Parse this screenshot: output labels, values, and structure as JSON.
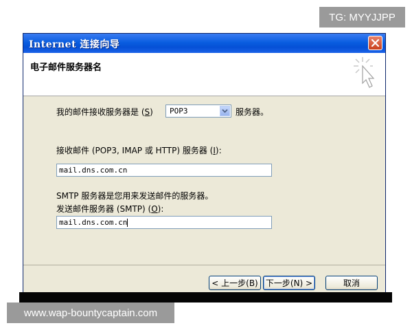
{
  "window": {
    "title": "Internet 连接向导"
  },
  "header": {
    "title": "电子邮件服务器名"
  },
  "incoming_type": {
    "label_prefix": "我的邮件接收服务器是 (",
    "label_key": "S",
    "label_suffix": ")",
    "selected": "POP3",
    "trailing": "服务器。"
  },
  "incoming_server": {
    "label_prefix": "接收邮件 (POP3, IMAP 或 HTTP) 服务器 (",
    "label_key": "I",
    "label_suffix": "):",
    "value": "mail.dns.com.cn"
  },
  "smtp_info": "SMTP 服务器是您用来发送邮件的服务器。",
  "outgoing_server": {
    "label_prefix": "发送邮件服务器 (SMTP) (",
    "label_key": "O",
    "label_suffix": "):",
    "value": "mail.dns.com.cn"
  },
  "buttons": {
    "back": "< 上一步(B)",
    "next": "下一步(N) >",
    "cancel": "取消"
  },
  "watermarks": {
    "top": "TG: MYYJJPP",
    "bottom": "www.wap-bountycaptain.com"
  }
}
